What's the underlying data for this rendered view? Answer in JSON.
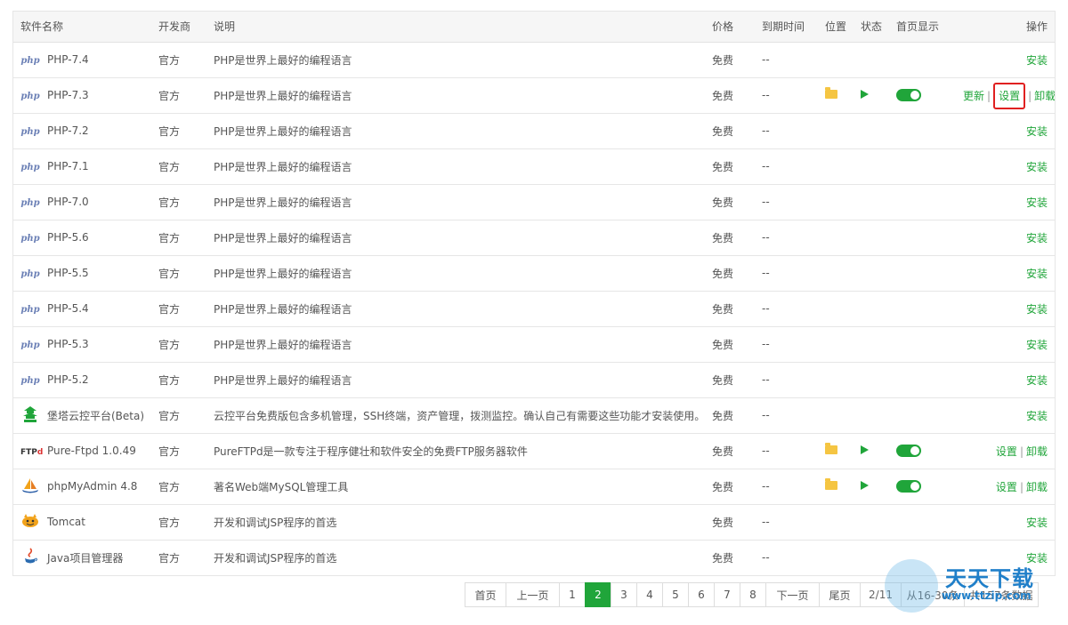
{
  "columns": {
    "name": "软件名称",
    "developer": "开发商",
    "description": "说明",
    "price": "价格",
    "expiry": "到期时间",
    "location": "位置",
    "status": "状态",
    "homepage": "首页显示",
    "actions": "操作"
  },
  "rows": [
    {
      "icon": "php-icon",
      "name": "PHP-7.4",
      "developer": "官方",
      "description": "PHP是世界上最好的编程语言",
      "price": "免费",
      "expiry": "--",
      "action": "安装"
    },
    {
      "icon": "php-icon",
      "name": "PHP-7.3",
      "developer": "官方",
      "description": "PHP是世界上最好的编程语言",
      "price": "免费",
      "expiry": "--",
      "actions": [
        "更新",
        "设置",
        "卸载"
      ]
    },
    {
      "icon": "php-icon",
      "name": "PHP-7.2",
      "developer": "官方",
      "description": "PHP是世界上最好的编程语言",
      "price": "免费",
      "expiry": "--",
      "action": "安装"
    },
    {
      "icon": "php-icon",
      "name": "PHP-7.1",
      "developer": "官方",
      "description": "PHP是世界上最好的编程语言",
      "price": "免费",
      "expiry": "--",
      "action": "安装"
    },
    {
      "icon": "php-icon",
      "name": "PHP-7.0",
      "developer": "官方",
      "description": "PHP是世界上最好的编程语言",
      "price": "免费",
      "expiry": "--",
      "action": "安装"
    },
    {
      "icon": "php-icon",
      "name": "PHP-5.6",
      "developer": "官方",
      "description": "PHP是世界上最好的编程语言",
      "price": "免费",
      "expiry": "--",
      "action": "安装"
    },
    {
      "icon": "php-icon",
      "name": "PHP-5.5",
      "developer": "官方",
      "description": "PHP是世界上最好的编程语言",
      "price": "免费",
      "expiry": "--",
      "action": "安装"
    },
    {
      "icon": "php-icon",
      "name": "PHP-5.4",
      "developer": "官方",
      "description": "PHP是世界上最好的编程语言",
      "price": "免费",
      "expiry": "--",
      "action": "安装"
    },
    {
      "icon": "php-icon",
      "name": "PHP-5.3",
      "developer": "官方",
      "description": "PHP是世界上最好的编程语言",
      "price": "免费",
      "expiry": "--",
      "action": "安装"
    },
    {
      "icon": "php-icon",
      "name": "PHP-5.2",
      "developer": "官方",
      "description": "PHP是世界上最好的编程语言",
      "price": "免费",
      "expiry": "--",
      "action": "安装"
    },
    {
      "icon": "pagoda-icon",
      "name": "堡塔云控平台(Beta)",
      "developer": "官方",
      "description": "云控平台免费版包含多机管理，SSH终端，资产管理，拨测监控。确认自己有需要这些功能才安装使用。",
      "price": "免费",
      "expiry": "--",
      "action": "安装"
    },
    {
      "icon": "ftp-icon",
      "name": "Pure-Ftpd 1.0.49",
      "developer": "官方",
      "description": "PureFTPd是一款专注于程序健壮和软件安全的免费FTP服务器软件",
      "price": "免费",
      "expiry": "--",
      "actions": [
        "设置",
        "卸载"
      ]
    },
    {
      "icon": "phpmyadmin-icon",
      "name": "phpMyAdmin 4.8",
      "developer": "官方",
      "description": "著名Web端MySQL管理工具",
      "price": "免费",
      "expiry": "--",
      "actions": [
        "设置",
        "卸载"
      ]
    },
    {
      "icon": "tomcat-icon",
      "name": "Tomcat",
      "developer": "官方",
      "description": "开发和调试JSP程序的首选",
      "price": "免费",
      "expiry": "--",
      "action": "安装"
    },
    {
      "icon": "java-icon",
      "name": "Java项目管理器",
      "developer": "官方",
      "description": "开发和调试JSP程序的首选",
      "price": "免费",
      "expiry": "--",
      "action": "安装"
    }
  ],
  "icons": {
    "php": "php",
    "ftp_prefix": "FTP",
    "ftp_mark": "d"
  },
  "pagination": {
    "first": "首页",
    "prev": "上一页",
    "pages": [
      "1",
      "2",
      "3",
      "4",
      "5",
      "6",
      "7",
      "8"
    ],
    "current": "2",
    "next": "下一页",
    "last": "尾页",
    "page_info": "2/11",
    "range": "从16-30条",
    "total": "共157条数据"
  },
  "watermark": {
    "title": "天天下载",
    "url": "www.ttzip.com"
  },
  "colors": {
    "accent": "#20a53a",
    "highlight": "#e02020",
    "folder": "#f5c542"
  }
}
